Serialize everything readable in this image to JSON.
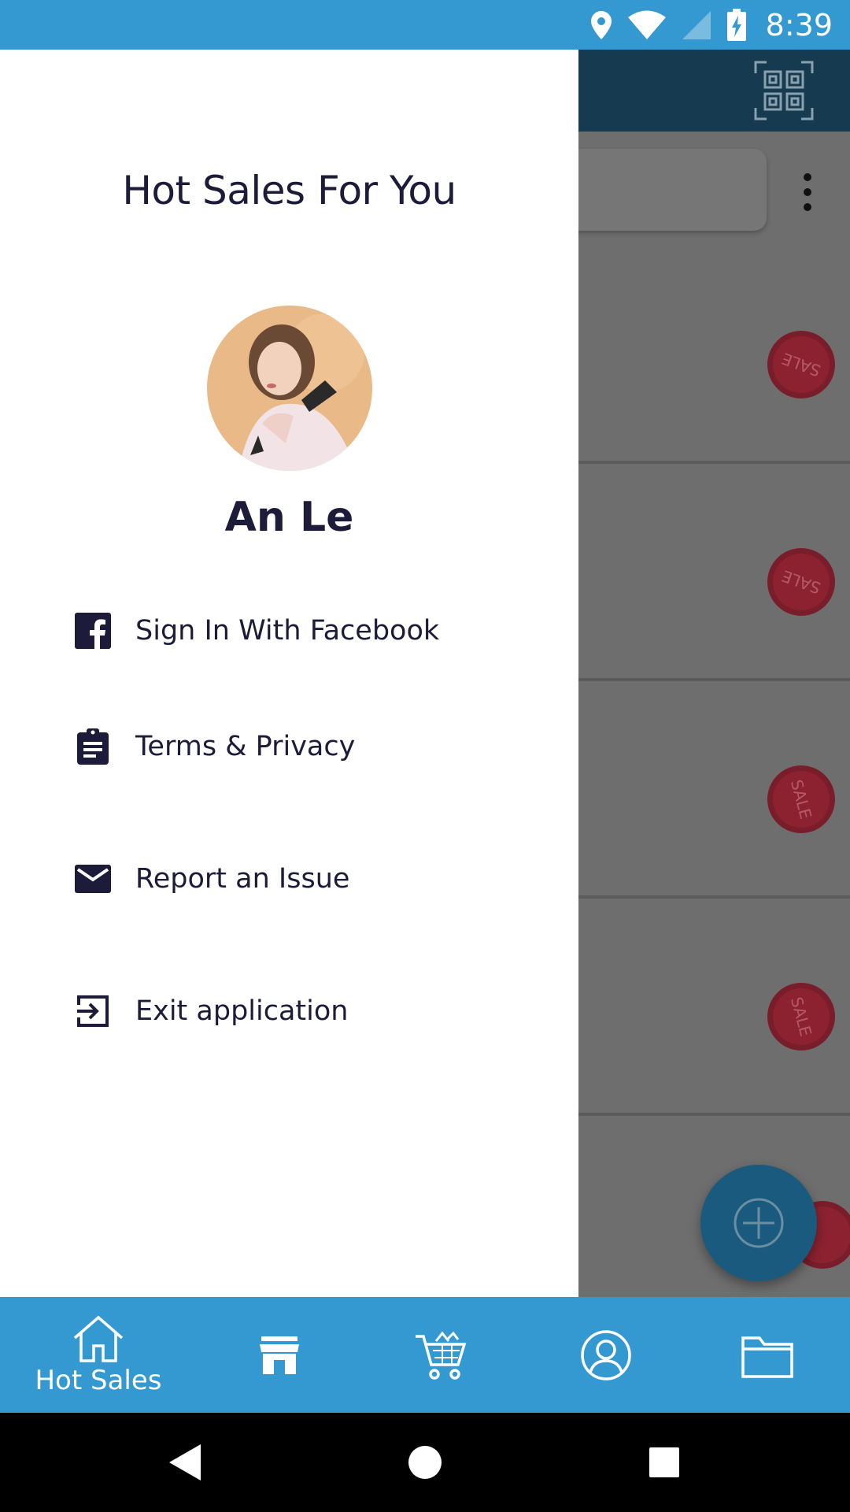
{
  "status_bar": {
    "time": "8:39",
    "icons": [
      "location-icon",
      "wifi-icon",
      "signal-icon",
      "battery-charging-icon"
    ]
  },
  "drawer": {
    "title": "Hot Sales For You",
    "user_name": "An Le",
    "menu": [
      {
        "label": "Sign In With Facebook",
        "icon": "facebook-icon"
      },
      {
        "label": "Terms & Privacy",
        "icon": "clipboard-icon"
      },
      {
        "label": "Report an Issue",
        "icon": "mail-icon"
      },
      {
        "label": "Exit application",
        "icon": "exit-icon"
      }
    ]
  },
  "background": {
    "badge_text": "SALE",
    "badge_color": "#c0202e"
  },
  "bottom_nav": {
    "items": [
      {
        "label": "Hot Sales",
        "icon": "home-icon",
        "active": true
      },
      {
        "label": "",
        "icon": "store-icon"
      },
      {
        "label": "",
        "icon": "cart-icon"
      },
      {
        "label": "",
        "icon": "profile-icon"
      },
      {
        "label": "",
        "icon": "folder-icon"
      }
    ]
  },
  "colors": {
    "accent": "#3399d0",
    "text_dark": "#1c1b3a",
    "toolbar_dim": "#163a50"
  }
}
